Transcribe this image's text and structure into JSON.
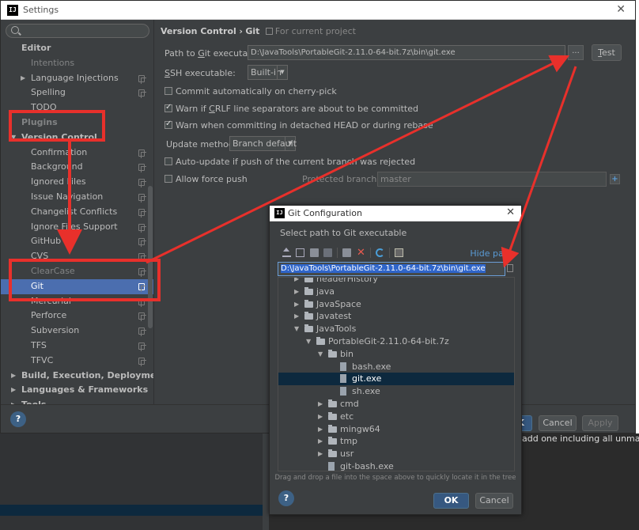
{
  "window": {
    "title": "Settings",
    "app_icon": "IJ"
  },
  "search": {
    "placeholder": ""
  },
  "sidebar": {
    "items": [
      {
        "label": "Editor",
        "level": 0,
        "bold": true,
        "arrow": ""
      },
      {
        "label": "Intentions",
        "level": 2,
        "copy": false,
        "arrow": "",
        "partial": true
      },
      {
        "label": "Language Injections",
        "level": 2,
        "copy": true,
        "arrow": "right"
      },
      {
        "label": "Spelling",
        "level": 2,
        "copy": true,
        "arrow": ""
      },
      {
        "label": "TODO",
        "level": 2,
        "copy": false,
        "arrow": ""
      },
      {
        "label": "Plugins",
        "level": 0,
        "bold": true,
        "arrow": "",
        "partial": true
      },
      {
        "label": "Version Control",
        "level": 0,
        "bold": true,
        "arrow": "down"
      },
      {
        "label": "Confirmation",
        "level": 2,
        "copy": true,
        "arrow": ""
      },
      {
        "label": "Background",
        "level": 2,
        "copy": true,
        "arrow": ""
      },
      {
        "label": "Ignored Files",
        "level": 2,
        "copy": true,
        "arrow": ""
      },
      {
        "label": "Issue Navigation",
        "level": 2,
        "copy": true,
        "arrow": ""
      },
      {
        "label": "Changelist Conflicts",
        "level": 2,
        "copy": true,
        "arrow": ""
      },
      {
        "label": "Ignore Files Support",
        "level": 2,
        "copy": true,
        "arrow": ""
      },
      {
        "label": "GitHub",
        "level": 2,
        "copy": true,
        "arrow": ""
      },
      {
        "label": "CVS",
        "level": 2,
        "copy": true,
        "arrow": ""
      },
      {
        "label": "ClearCase",
        "level": 2,
        "copy": true,
        "arrow": "",
        "partial": true
      },
      {
        "label": "Git",
        "level": 2,
        "copy": true,
        "arrow": "",
        "selected": true
      },
      {
        "label": "Mercurial",
        "level": 2,
        "copy": true,
        "arrow": ""
      },
      {
        "label": "Perforce",
        "level": 2,
        "copy": true,
        "arrow": ""
      },
      {
        "label": "Subversion",
        "level": 2,
        "copy": true,
        "arrow": ""
      },
      {
        "label": "TFS",
        "level": 2,
        "copy": true,
        "arrow": ""
      },
      {
        "label": "TFVC",
        "level": 2,
        "copy": true,
        "arrow": ""
      },
      {
        "label": "Build, Execution, Deployment",
        "level": 0,
        "bold": true,
        "arrow": "right"
      },
      {
        "label": "Languages & Frameworks",
        "level": 0,
        "bold": true,
        "arrow": "right"
      },
      {
        "label": "Tools",
        "level": 0,
        "bold": true,
        "arrow": "right"
      }
    ]
  },
  "main": {
    "crumb_section": "Version Control",
    "crumb_sep": "›",
    "crumb_page": "Git",
    "crumb_scope": "For current project",
    "path_label_pre": "Path to ",
    "path_label_u": "G",
    "path_label_post": "it executable:",
    "path_value": "D:\\JavaTools\\PortableGit-2.11.0-64-bit.7z\\bin\\git.exe",
    "dots_label": "...",
    "test_label_u": "T",
    "test_label_rest": "est",
    "ssh_label_u": "S",
    "ssh_label_rest": "SH executable:",
    "ssh_value": "Built-in",
    "opt_cherry": "Commit automatically on cherry-pick",
    "opt_crlf_pre": "Warn if ",
    "opt_crlf_u": "C",
    "opt_crlf_post": "RLF line separators are about to be committed",
    "opt_detached": "Warn when committing in detached HEAD or during rebase",
    "update_label": "Update method:",
    "update_value": "Branch default",
    "opt_autoupdate": "Auto-update if push of the current branch was rejected",
    "opt_force": "Allow force push",
    "protected_label": "Protected branches:",
    "protected_value": "master"
  },
  "buttons": {
    "ok": "OK",
    "cancel": "Cancel",
    "apply": "Apply",
    "help": "?"
  },
  "ide_hint": "add one including all unmapped",
  "git_dialog": {
    "title": "Git Configuration",
    "prompt": "Select path to Git executable",
    "hide_path": "Hide path",
    "path_value": "D:\\JavaTools\\PortableGit-2.11.0-64-bit.7z\\bin\\git.exe",
    "tree": [
      {
        "name": "headerHistory",
        "indent": 1,
        "type": "folder",
        "arrow": "right",
        "partial": true
      },
      {
        "name": "java",
        "indent": 1,
        "type": "folder",
        "arrow": "right"
      },
      {
        "name": "JavaSpace",
        "indent": 1,
        "type": "folder",
        "arrow": "right"
      },
      {
        "name": "Javatest",
        "indent": 1,
        "type": "folder",
        "arrow": "right"
      },
      {
        "name": "JavaTools",
        "indent": 1,
        "type": "folder",
        "arrow": "down"
      },
      {
        "name": "PortableGit-2.11.0-64-bit.7z",
        "indent": 2,
        "type": "folder",
        "arrow": "down"
      },
      {
        "name": "bin",
        "indent": 3,
        "type": "folder",
        "arrow": "down"
      },
      {
        "name": "bash.exe",
        "indent": 4,
        "type": "file",
        "arrow": ""
      },
      {
        "name": "git.exe",
        "indent": 4,
        "type": "file",
        "arrow": "",
        "selected": true
      },
      {
        "name": "sh.exe",
        "indent": 4,
        "type": "file",
        "arrow": ""
      },
      {
        "name": "cmd",
        "indent": 3,
        "type": "folder",
        "arrow": "right"
      },
      {
        "name": "etc",
        "indent": 3,
        "type": "folder",
        "arrow": "right"
      },
      {
        "name": "mingw64",
        "indent": 3,
        "type": "folder",
        "arrow": "right"
      },
      {
        "name": "tmp",
        "indent": 3,
        "type": "folder",
        "arrow": "right"
      },
      {
        "name": "usr",
        "indent": 3,
        "type": "folder",
        "arrow": "right"
      },
      {
        "name": "git-bash.exe",
        "indent": 3,
        "type": "file",
        "arrow": ""
      }
    ],
    "hint": "Drag and drop a file into the space above to quickly locate it in the tree",
    "ok": "OK",
    "cancel": "Cancel",
    "help": "?"
  },
  "colors": {
    "annotation": "#e8302b",
    "selection": "#4b6eaf",
    "link": "#5a9bd5",
    "ok_button": "#365880"
  }
}
